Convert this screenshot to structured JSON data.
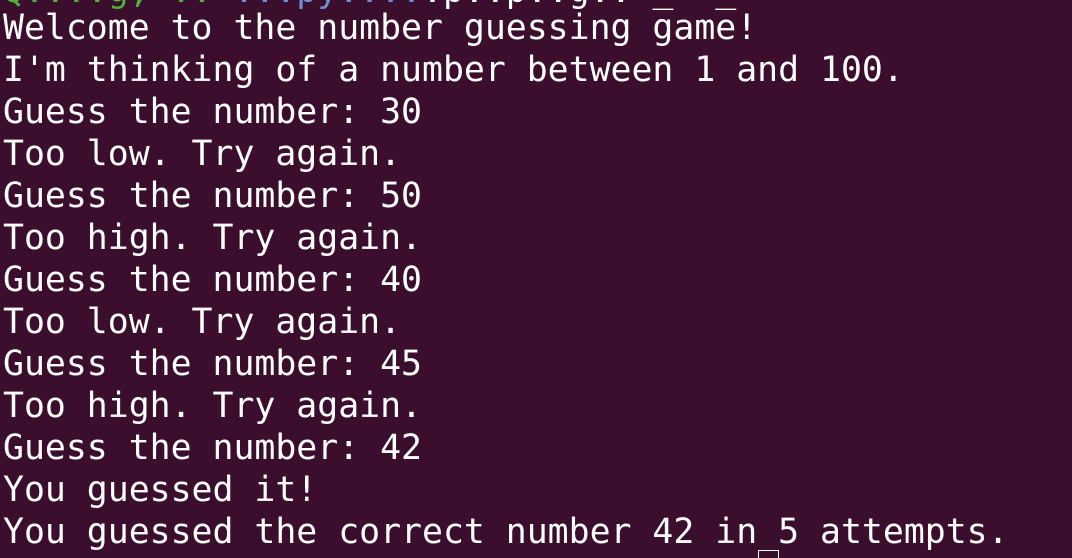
{
  "terminal": {
    "background": "#3a0e2c",
    "foreground": "#ffffff",
    "prompt_clipped": {
      "user_host": "Q....g, ..",
      "path": "...py....",
      "tail": ".p..p..g.. _  _"
    },
    "lines": [
      "Welcome to the number guessing game!",
      "I'm thinking of a number between 1 and 100.",
      "Guess the number: 30",
      "Too low. Try again.",
      "Guess the number: 50",
      "Too high. Try again.",
      "Guess the number: 40",
      "Too low. Try again.",
      "Guess the number: 45",
      "Too high. Try again.",
      "Guess the number: 42",
      "You guessed it!",
      "You guessed the correct number 42 in 5 attempts."
    ]
  }
}
